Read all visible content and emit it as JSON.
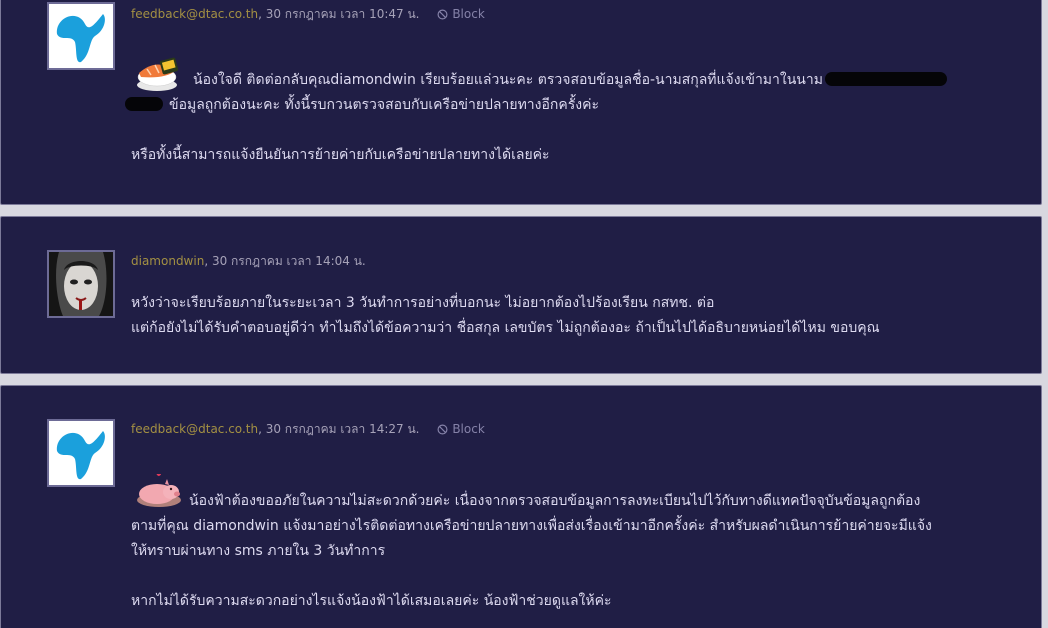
{
  "comments": [
    {
      "author": "feedback@dtac.co.th",
      "date": "30 กรกฎาคม เวลา 10:47 น.",
      "block_label": "Block",
      "emoticon": "sushi-emoticon",
      "lines": [
        "น้องใจดี  ติดต่อกลับคุณdiamondwin  เรียบร้อยแล่วนะคะ  ตรวจสอบข้อมูลชื่อ-นามสกุลที่แจ้งเข้ามาในนาม",
        "ข้อมูลถูกต้องนะคะ  ทั้งนี้รบกวนตรวจสอบกับเครือข่ายปลายทางอีกครั้งค่ะ",
        "หรือทั้งนี้สามารถแจ้งยืนยันการย้ายค่ายกับเครือข่ายปลายทางได้เลยค่ะ"
      ]
    },
    {
      "author": "diamondwin",
      "date": "30 กรกฎาคม เวลา 14:04 น.",
      "lines": [
        "หวังว่าจะเรียบร้อยภายในระยะเวลา 3 วันทำการอย่างที่บอกนะ ไม่อยากต้องไปร้องเรียน กสทช. ต่อ",
        "แต่ก้อยังไม่ได้รับคำตอบอยู่ดีว่า ทำไมถึงได้ข้อความว่า ชื่อสกุล เลขบัตร ไม่ถูกต้องอะ ถ้าเป็นไปได้อธิบายหน่อยได้ไหม ขอบคุณ"
      ]
    },
    {
      "author": "feedback@dtac.co.th",
      "date": "30 กรกฎาคม เวลา 14:27 น.",
      "block_label": "Block",
      "emoticon": "pig-emoticon",
      "lines": [
        "น้องฟ้าต้องขออภัยในความไม่สะดวกด้วยค่ะ  เนื่องจากตรวจสอบข้อมูลการลงทะเบียนไปไว้กับทางดีแทคปัจจุบันข้อมูลถูกต้อง",
        "ตามที่คุณ diamondwin แจ้งมาอย่างไรติดต่อทางเครือข่ายปลายทางเพื่อส่งเรื่องเข้ามาอีกครั้งค่ะ   สำหรับผลดำเนินการย้ายค่ายจะมีแจ้ง",
        "ให้ทราบผ่านทาง sms ภายใน 3 วันทำการ",
        "หากไม่ได้รับความสะดวกอย่างไรแจ้งน้องฟ้าได้เสมอเลยค่ะ น้องฟ้าช่วยดูแลให้ค่ะ"
      ]
    }
  ],
  "colors": {
    "card_bg": "#201e45",
    "author": "#a39043",
    "text": "#dddaf0",
    "dtac_blue": "#1ba0dc"
  }
}
